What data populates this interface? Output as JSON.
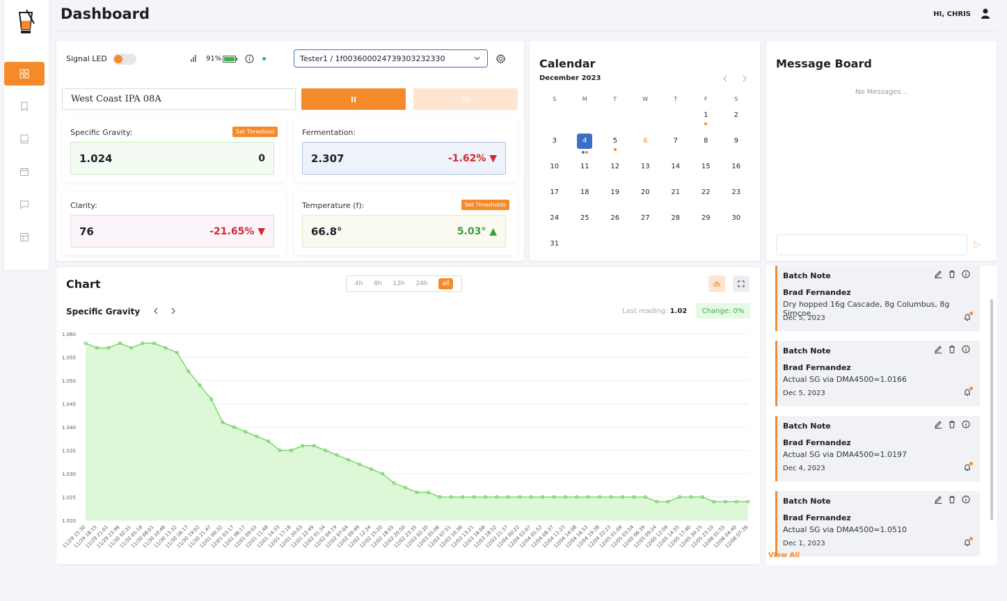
{
  "header": {
    "title": "Dashboard",
    "greeting": "HI, CHRIS"
  },
  "sidebar": {
    "items": [
      "dashboard",
      "bookmark",
      "book",
      "calendar",
      "message",
      "layout"
    ]
  },
  "controls": {
    "signal_led_label": "Signal LED",
    "battery_pct": "91%",
    "device_select": "Tester1 / 1f003600024739303232330",
    "batch_name": "West Coast IPA 08A"
  },
  "metrics": {
    "specific_gravity": {
      "label": "Specific Gravity:",
      "value": "1.024",
      "right": "0",
      "button": "Set Threshold"
    },
    "fermentation": {
      "label": "Fermentation:",
      "value": "2.307",
      "change": "-1.62% ▼"
    },
    "clarity": {
      "label": "Clarity:",
      "value": "76",
      "change": "-21.65% ▼"
    },
    "temperature": {
      "label": "Temperature (f):",
      "value": "66.8°",
      "change": "5.03° ▲",
      "button": "Set Thresholds"
    }
  },
  "calendar": {
    "title": "Calendar",
    "month": "December 2023",
    "weekdays": [
      "S",
      "M",
      "T",
      "W",
      "T",
      "F",
      "S"
    ],
    "weeks": [
      [
        "",
        "",
        "",
        "",
        "",
        "1",
        "2"
      ],
      [
        "3",
        "4",
        "5",
        "6",
        "7",
        "8",
        "9"
      ],
      [
        "10",
        "11",
        "12",
        "13",
        "14",
        "15",
        "16"
      ],
      [
        "17",
        "18",
        "19",
        "20",
        "21",
        "22",
        "23"
      ],
      [
        "24",
        "25",
        "26",
        "27",
        "28",
        "29",
        "30"
      ],
      [
        "31",
        "",
        "",
        "",
        "",
        "",
        ""
      ]
    ]
  },
  "message_board": {
    "title": "Message Board",
    "empty_text": "No Messages ..",
    "view_all": "View All"
  },
  "notes": [
    {
      "title": "Batch Note",
      "author": "Brad Fernandez",
      "text": "Dry hopped 16g Cascade, 8g Columbus, 8g Simcoe.",
      "date": "Dec 5, 2023"
    },
    {
      "title": "Batch Note",
      "author": "Brad Fernandez",
      "text": "Actual SG via DMA4500=1.0166",
      "date": "Dec 5, 2023"
    },
    {
      "title": "Batch Note",
      "author": "Brad Fernandez",
      "text": "Actual SG via DMA4500=1.0197",
      "date": "Dec 4, 2023"
    },
    {
      "title": "Batch Note",
      "author": "Brad Fernandez",
      "text": "Actual SG via DMA4500=1.0510",
      "date": "Dec 1, 2023"
    }
  ],
  "chart": {
    "title": "Chart",
    "series_title": "Specific Gravity",
    "ranges": [
      "4h",
      "8h",
      "12h",
      "24h",
      "all"
    ],
    "active_range": "all",
    "last_reading_label": "Last reading:",
    "last_reading_value": "1.02",
    "change_text": "Change: 0%"
  },
  "chart_data": {
    "type": "area",
    "ylim": [
      1.02,
      1.06
    ],
    "yticks": [
      "1.060",
      "1.055",
      "1.050",
      "1.045",
      "1.040",
      "1.035",
      "1.030",
      "1.025",
      "1.020"
    ],
    "xticks": [
      "11/29 15:30",
      "11/29 18:15",
      "11/29 21:01",
      "11/29 23:46",
      "11/30 02:31",
      "11/30 05:16",
      "11/30 08:01",
      "11/30 10:46",
      "11/30 13:32",
      "11/30 16:17",
      "11/30 19:02",
      "11/30 21:47",
      "12/01 00:32",
      "12/01 03:17",
      "12/01 06:17",
      "12/01 09:03",
      "12/01 11:48",
      "12/01 14:33",
      "12/01 17:18",
      "12/01 20:03",
      "12/01 22:49",
      "12/02 01:34",
      "12/02 04:19",
      "12/02 07:04",
      "12/02 09:49",
      "12/02 12:34",
      "12/02 15:20",
      "12/02 18:05",
      "12/02 20:50",
      "12/02 23:35",
      "12/03 02:20",
      "12/03 05:06",
      "12/03 07:51",
      "12/03 10:36",
      "12/03 13:21",
      "12/03 16:06",
      "12/03 18:52",
      "12/03 21:37",
      "12/04 00:22",
      "12/04 03:07",
      "12/04 05:52",
      "12/04 08:37",
      "12/04 11:23",
      "12/04 14:08",
      "12/04 16:53",
      "12/04 19:38",
      "12/04 22:23",
      "12/05 01:09",
      "12/05 03:54",
      "12/05 06:39",
      "12/05 09:24",
      "12/05 12:09",
      "12/05 14:55",
      "12/05 17:40",
      "12/05 20:25",
      "12/05 23:10",
      "12/06 01:55",
      "12/06 04:40",
      "12/06 07:26"
    ],
    "values": [
      1.058,
      1.057,
      1.057,
      1.058,
      1.057,
      1.058,
      1.058,
      1.057,
      1.056,
      1.052,
      1.049,
      1.046,
      1.041,
      1.04,
      1.039,
      1.038,
      1.037,
      1.035,
      1.035,
      1.036,
      1.036,
      1.035,
      1.034,
      1.033,
      1.032,
      1.031,
      1.03,
      1.028,
      1.027,
      1.026,
      1.026,
      1.025,
      1.025,
      1.025,
      1.025,
      1.025,
      1.025,
      1.025,
      1.025,
      1.025,
      1.025,
      1.025,
      1.025,
      1.025,
      1.025,
      1.025,
      1.025,
      1.025,
      1.025,
      1.025,
      1.024,
      1.024,
      1.025,
      1.025,
      1.025,
      1.024,
      1.024,
      1.024,
      1.024
    ]
  }
}
